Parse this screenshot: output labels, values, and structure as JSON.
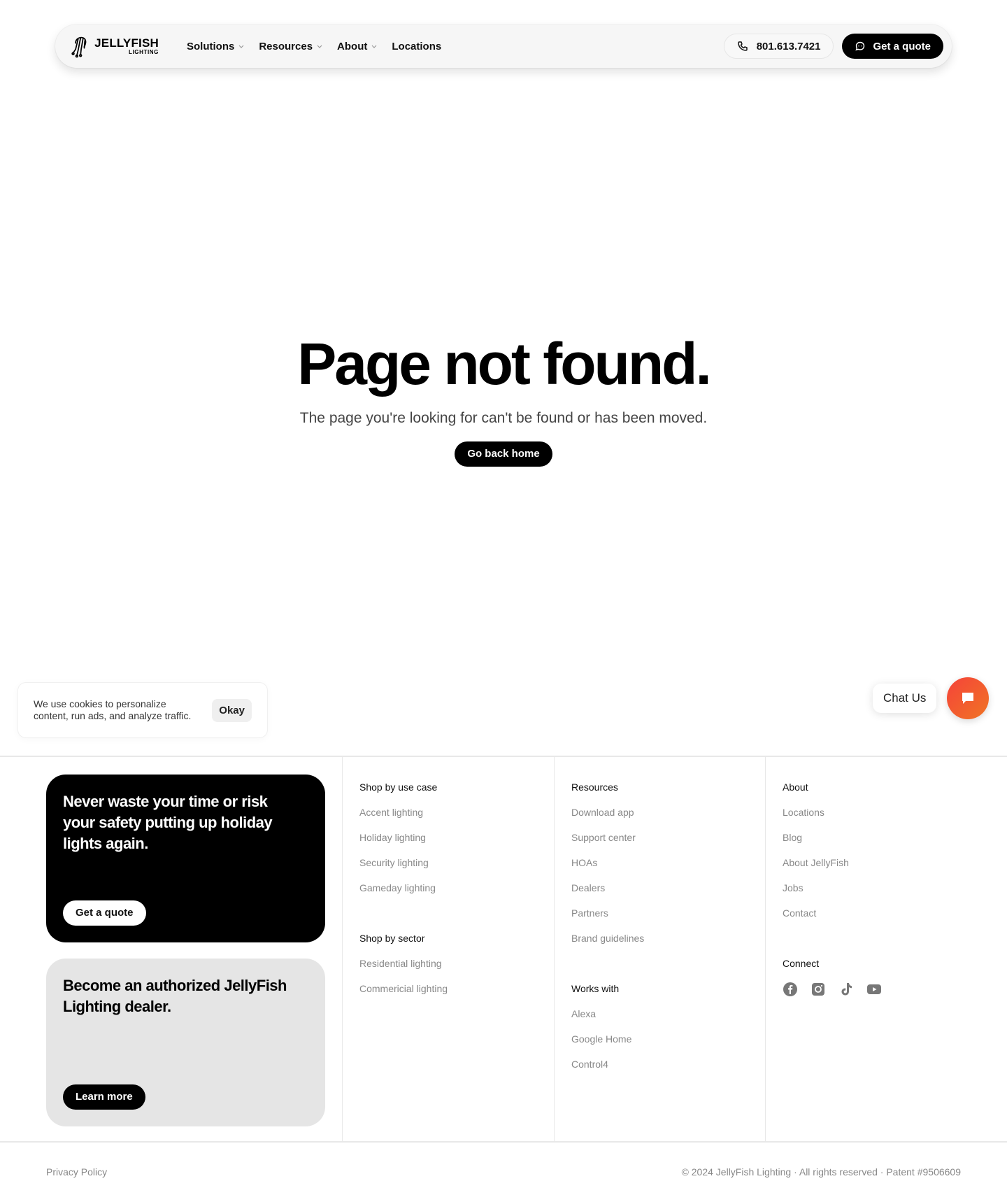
{
  "nav": {
    "logo_main": "JELLYFISH",
    "logo_sub": "LIGHTING",
    "links": [
      {
        "label": "Solutions",
        "has_dropdown": true
      },
      {
        "label": "Resources",
        "has_dropdown": true
      },
      {
        "label": "About",
        "has_dropdown": true
      },
      {
        "label": "Locations",
        "has_dropdown": false
      }
    ],
    "phone": "801.613.7421",
    "quote_label": "Get a quote"
  },
  "hero": {
    "title": "Page not found.",
    "subtitle": "The page you're looking for can't be found or has been moved.",
    "button_label": "Go back home"
  },
  "cookie": {
    "text": "We use cookies to personalize content, run ads, and analyze traffic.",
    "button_label": "Okay"
  },
  "chat": {
    "label": "Chat Us",
    "accent_colors": [
      "#f5433a",
      "#f07424"
    ]
  },
  "footer": {
    "cards": [
      {
        "title": "Never waste your time or risk your safety putting up holiday lights again.",
        "button_label": "Get a quote"
      },
      {
        "title": "Become an authorized JellyFish Lighting dealer.",
        "button_label": "Learn more"
      }
    ],
    "columns": [
      {
        "groups": [
          {
            "heading": "Shop by use case",
            "links": [
              "Accent lighting",
              "Holiday lighting",
              "Security lighting",
              "Gameday lighting"
            ]
          },
          {
            "heading": "Shop by sector",
            "links": [
              "Residential lighting",
              "Commericial lighting"
            ]
          }
        ]
      },
      {
        "groups": [
          {
            "heading": "Resources",
            "links": [
              "Download app",
              "Support center",
              "HOAs",
              "Dealers",
              "Partners",
              "Brand guidelines"
            ]
          },
          {
            "heading": "Works with",
            "links": [
              "Alexa",
              "Google Home",
              "Control4"
            ]
          }
        ]
      },
      {
        "groups": [
          {
            "heading": "About",
            "links": [
              "Locations",
              "Blog",
              "About JellyFish",
              "Jobs",
              "Contact"
            ]
          }
        ],
        "connect": {
          "heading": "Connect",
          "icons": [
            "facebook-icon",
            "instagram-icon",
            "tiktok-icon",
            "youtube-icon"
          ]
        }
      }
    ],
    "privacy_label": "Privacy Policy",
    "copyright": "© 2024 JellyFish Lighting · All rights reserved · Patent #9506609"
  }
}
